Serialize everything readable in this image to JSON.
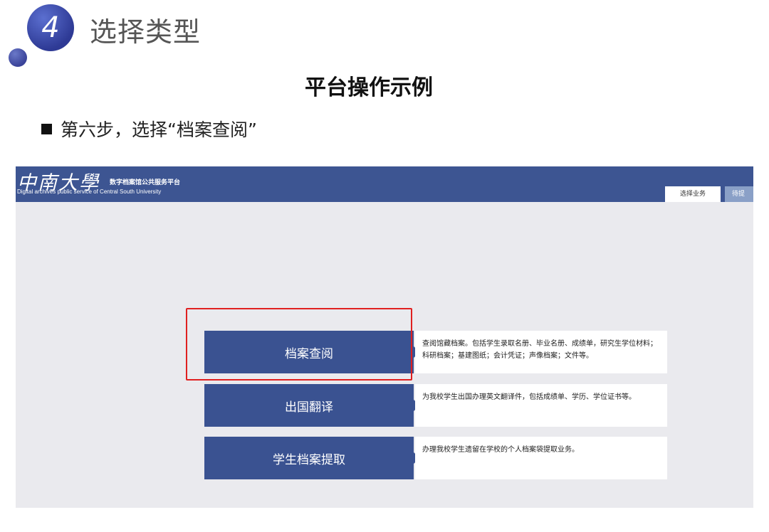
{
  "slide": {
    "step_number": "4",
    "title": "选择类型",
    "heading": "平台操作示例",
    "bullet": "第六步，选择“档案查阅”"
  },
  "screen": {
    "logo_cn": "中南大學",
    "logo_subtitle": "数字档案馆公共服务平台",
    "logo_en": "Digital archives public service of Central South University",
    "tabs": [
      {
        "label": "选择业务",
        "active": true
      },
      {
        "label": "待提",
        "active": false
      }
    ],
    "services": [
      {
        "label": "档案查阅",
        "description": "查阅馆藏档案。包括学生录取名册、毕业名册、成绩单，研究生学位材料；科研档案；基建图纸；会计凭证；声像档案；文件等。",
        "highlighted": true
      },
      {
        "label": "出国翻译",
        "description": "为我校学生出国办理英文翻译件，包括成绩单、学历、学位证书等。",
        "highlighted": false
      },
      {
        "label": "学生档案提取",
        "description": "办理我校学生遗留在学校的个人档案袋提取业务。",
        "highlighted": false
      }
    ]
  },
  "colors": {
    "accent": "#3a5291",
    "topbar": "#3d5592",
    "highlight": "#e02020"
  }
}
